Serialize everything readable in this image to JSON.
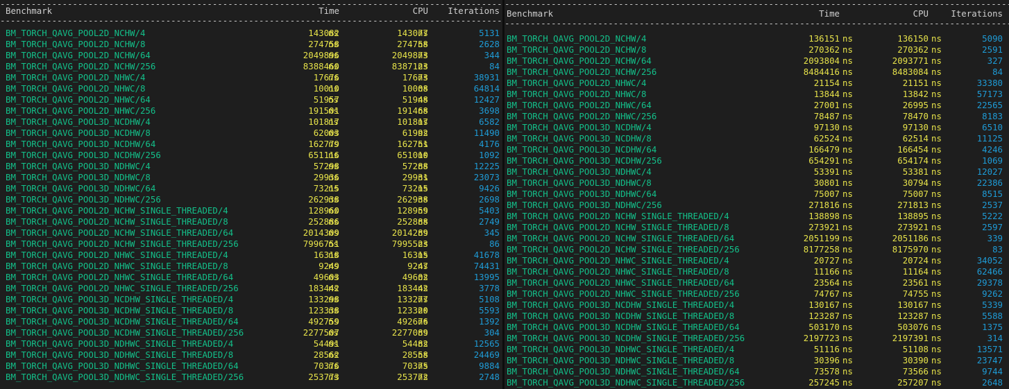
{
  "panels": [
    {
      "headers": {
        "benchmark": "Benchmark",
        "time": "Time",
        "cpu": "CPU",
        "iterations": "Iterations"
      },
      "separator": "--------------------------------------------------------------------------------------------------------",
      "rows": [
        {
          "name": "BM_TORCH_QAVG_POOL2D_NCHW/4",
          "time": "143082",
          "time_unit": "ns",
          "cpu": "143077",
          "cpu_unit": "ns",
          "iterations": "5131"
        },
        {
          "name": "BM_TORCH_QAVG_POOL2D_NCHW/8",
          "time": "274758",
          "time_unit": "ns",
          "cpu": "274758",
          "cpu_unit": "ns",
          "iterations": "2628"
        },
        {
          "name": "BM_TORCH_QAVG_POOL2D_NCHW/64",
          "time": "2049896",
          "time_unit": "ns",
          "cpu": "2049873",
          "cpu_unit": "ns",
          "iterations": "344"
        },
        {
          "name": "BM_TORCH_QAVG_POOL2D_NCHW/256",
          "time": "8388460",
          "time_unit": "ns",
          "cpu": "8387123",
          "cpu_unit": "ns",
          "iterations": "84"
        },
        {
          "name": "BM_TORCH_QAVG_POOL2D_NHWC/4",
          "time": "17676",
          "time_unit": "ns",
          "cpu": "17673",
          "cpu_unit": "ns",
          "iterations": "38931"
        },
        {
          "name": "BM_TORCH_QAVG_POOL2D_NHWC/8",
          "time": "10010",
          "time_unit": "ns",
          "cpu": "10008",
          "cpu_unit": "ns",
          "iterations": "64814"
        },
        {
          "name": "BM_TORCH_QAVG_POOL2D_NHWC/64",
          "time": "51957",
          "time_unit": "ns",
          "cpu": "51948",
          "cpu_unit": "ns",
          "iterations": "12427"
        },
        {
          "name": "BM_TORCH_QAVG_POOL2D_NHWC/256",
          "time": "191501",
          "time_unit": "ns",
          "cpu": "191468",
          "cpu_unit": "ns",
          "iterations": "3698"
        },
        {
          "name": "BM_TORCH_QAVG_POOL3D_NCDHW/4",
          "time": "101817",
          "time_unit": "ns",
          "cpu": "101817",
          "cpu_unit": "ns",
          "iterations": "6582"
        },
        {
          "name": "BM_TORCH_QAVG_POOL3D_NCDHW/8",
          "time": "62003",
          "time_unit": "ns",
          "cpu": "61992",
          "cpu_unit": "ns",
          "iterations": "11490"
        },
        {
          "name": "BM_TORCH_QAVG_POOL3D_NCDHW/64",
          "time": "162779",
          "time_unit": "ns",
          "cpu": "162751",
          "cpu_unit": "ns",
          "iterations": "4176"
        },
        {
          "name": "BM_TORCH_QAVG_POOL3D_NCDHW/256",
          "time": "651116",
          "time_unit": "ns",
          "cpu": "651010",
          "cpu_unit": "ns",
          "iterations": "1092"
        },
        {
          "name": "BM_TORCH_QAVG_POOL3D_NDHWC/4",
          "time": "57298",
          "time_unit": "ns",
          "cpu": "57288",
          "cpu_unit": "ns",
          "iterations": "12225"
        },
        {
          "name": "BM_TORCH_QAVG_POOL3D_NDHWC/8",
          "time": "29936",
          "time_unit": "ns",
          "cpu": "29931",
          "cpu_unit": "ns",
          "iterations": "23073"
        },
        {
          "name": "BM_TORCH_QAVG_POOL3D_NDHWC/64",
          "time": "73215",
          "time_unit": "ns",
          "cpu": "73215",
          "cpu_unit": "ns",
          "iterations": "9426"
        },
        {
          "name": "BM_TORCH_QAVG_POOL3D_NDHWC/256",
          "time": "262938",
          "time_unit": "ns",
          "cpu": "262938",
          "cpu_unit": "ns",
          "iterations": "2698"
        },
        {
          "name": "BM_TORCH_QAVG_POOL2D_NCHW_SINGLE_THREADED/4",
          "time": "128960",
          "time_unit": "ns",
          "cpu": "128959",
          "cpu_unit": "ns",
          "iterations": "5403"
        },
        {
          "name": "BM_TORCH_QAVG_POOL2D_NCHW_SINGLE_THREADED/8",
          "time": "252886",
          "time_unit": "ns",
          "cpu": "252888",
          "cpu_unit": "ns",
          "iterations": "2749"
        },
        {
          "name": "BM_TORCH_QAVG_POOL2D_NCHW_SINGLE_THREADED/64",
          "time": "2014309",
          "time_unit": "ns",
          "cpu": "2014289",
          "cpu_unit": "ns",
          "iterations": "345"
        },
        {
          "name": "BM_TORCH_QAVG_POOL2D_NCHW_SINGLE_THREADED/256",
          "time": "7996751",
          "time_unit": "ns",
          "cpu": "7995523",
          "cpu_unit": "ns",
          "iterations": "86"
        },
        {
          "name": "BM_TORCH_QAVG_POOL2D_NHWC_SINGLE_THREADED/4",
          "time": "16318",
          "time_unit": "ns",
          "cpu": "16315",
          "cpu_unit": "ns",
          "iterations": "41678"
        },
        {
          "name": "BM_TORCH_QAVG_POOL2D_NHWC_SINGLE_THREADED/8",
          "time": "9249",
          "time_unit": "ns",
          "cpu": "9247",
          "cpu_unit": "ns",
          "iterations": "74431"
        },
        {
          "name": "BM_TORCH_QAVG_POOL2D_NHWC_SINGLE_THREADED/64",
          "time": "49603",
          "time_unit": "ns",
          "cpu": "49602",
          "cpu_unit": "ns",
          "iterations": "13995"
        },
        {
          "name": "BM_TORCH_QAVG_POOL2D_NHWC_SINGLE_THREADED/256",
          "time": "183442",
          "time_unit": "ns",
          "cpu": "183442",
          "cpu_unit": "ns",
          "iterations": "3778"
        },
        {
          "name": "BM_TORCH_QAVG_POOL3D_NCDHW_SINGLE_THREADED/4",
          "time": "133298",
          "time_unit": "ns",
          "cpu": "133277",
          "cpu_unit": "ns",
          "iterations": "5108"
        },
        {
          "name": "BM_TORCH_QAVG_POOL3D_NCDHW_SINGLE_THREADED/8",
          "time": "123338",
          "time_unit": "ns",
          "cpu": "123320",
          "cpu_unit": "ns",
          "iterations": "5593"
        },
        {
          "name": "BM_TORCH_QAVG_POOL3D_NCDHW_SINGLE_THREADED/64",
          "time": "492759",
          "time_unit": "ns",
          "cpu": "492676",
          "cpu_unit": "ns",
          "iterations": "1392"
        },
        {
          "name": "BM_TORCH_QAVG_POOL3D_NCDHW_SINGLE_THREADED/256",
          "time": "2277507",
          "time_unit": "ns",
          "cpu": "2277089",
          "cpu_unit": "ns",
          "iterations": "304"
        },
        {
          "name": "BM_TORCH_QAVG_POOL3D_NDHWC_SINGLE_THREADED/4",
          "time": "54491",
          "time_unit": "ns",
          "cpu": "54482",
          "cpu_unit": "ns",
          "iterations": "12565"
        },
        {
          "name": "BM_TORCH_QAVG_POOL3D_NDHWC_SINGLE_THREADED/8",
          "time": "28562",
          "time_unit": "ns",
          "cpu": "28558",
          "cpu_unit": "ns",
          "iterations": "24469"
        },
        {
          "name": "BM_TORCH_QAVG_POOL3D_NDHWC_SINGLE_THREADED/64",
          "time": "70376",
          "time_unit": "ns",
          "cpu": "70375",
          "cpu_unit": "ns",
          "iterations": "9884"
        },
        {
          "name": "BM_TORCH_QAVG_POOL3D_NDHWC_SINGLE_THREADED/256",
          "time": "253773",
          "time_unit": "ns",
          "cpu": "253772",
          "cpu_unit": "ns",
          "iterations": "2748"
        }
      ]
    },
    {
      "headers": {
        "benchmark": "Benchmark",
        "time": "Time",
        "cpu": "CPU",
        "iterations": "Iterations"
      },
      "separator": "--------------------------------------------------------------------------------------------------------",
      "rows": [
        {
          "name": "BM_TORCH_QAVG_POOL2D_NCHW/4",
          "time": "136151",
          "time_unit": "ns",
          "cpu": "136150",
          "cpu_unit": "ns",
          "iterations": "5090"
        },
        {
          "name": "BM_TORCH_QAVG_POOL2D_NCHW/8",
          "time": "270362",
          "time_unit": "ns",
          "cpu": "270362",
          "cpu_unit": "ns",
          "iterations": "2591"
        },
        {
          "name": "BM_TORCH_QAVG_POOL2D_NCHW/64",
          "time": "2093804",
          "time_unit": "ns",
          "cpu": "2093771",
          "cpu_unit": "ns",
          "iterations": "327"
        },
        {
          "name": "BM_TORCH_QAVG_POOL2D_NCHW/256",
          "time": "8484416",
          "time_unit": "ns",
          "cpu": "8483084",
          "cpu_unit": "ns",
          "iterations": "84"
        },
        {
          "name": "BM_TORCH_QAVG_POOL2D_NHWC/4",
          "time": "21154",
          "time_unit": "ns",
          "cpu": "21151",
          "cpu_unit": "ns",
          "iterations": "33380"
        },
        {
          "name": "BM_TORCH_QAVG_POOL2D_NHWC/8",
          "time": "13844",
          "time_unit": "ns",
          "cpu": "13842",
          "cpu_unit": "ns",
          "iterations": "57173"
        },
        {
          "name": "BM_TORCH_QAVG_POOL2D_NHWC/64",
          "time": "27001",
          "time_unit": "ns",
          "cpu": "26995",
          "cpu_unit": "ns",
          "iterations": "22565"
        },
        {
          "name": "BM_TORCH_QAVG_POOL2D_NHWC/256",
          "time": "78487",
          "time_unit": "ns",
          "cpu": "78470",
          "cpu_unit": "ns",
          "iterations": "8183"
        },
        {
          "name": "BM_TORCH_QAVG_POOL3D_NCDHW/4",
          "time": "97130",
          "time_unit": "ns",
          "cpu": "97130",
          "cpu_unit": "ns",
          "iterations": "6510"
        },
        {
          "name": "BM_TORCH_QAVG_POOL3D_NCDHW/8",
          "time": "62524",
          "time_unit": "ns",
          "cpu": "62514",
          "cpu_unit": "ns",
          "iterations": "11125"
        },
        {
          "name": "BM_TORCH_QAVG_POOL3D_NCDHW/64",
          "time": "166479",
          "time_unit": "ns",
          "cpu": "166454",
          "cpu_unit": "ns",
          "iterations": "4246"
        },
        {
          "name": "BM_TORCH_QAVG_POOL3D_NCDHW/256",
          "time": "654291",
          "time_unit": "ns",
          "cpu": "654174",
          "cpu_unit": "ns",
          "iterations": "1069"
        },
        {
          "name": "BM_TORCH_QAVG_POOL3D_NDHWC/4",
          "time": "53391",
          "time_unit": "ns",
          "cpu": "53381",
          "cpu_unit": "ns",
          "iterations": "12027"
        },
        {
          "name": "BM_TORCH_QAVG_POOL3D_NDHWC/8",
          "time": "30801",
          "time_unit": "ns",
          "cpu": "30794",
          "cpu_unit": "ns",
          "iterations": "22386"
        },
        {
          "name": "BM_TORCH_QAVG_POOL3D_NDHWC/64",
          "time": "75007",
          "time_unit": "ns",
          "cpu": "75007",
          "cpu_unit": "ns",
          "iterations": "8515"
        },
        {
          "name": "BM_TORCH_QAVG_POOL3D_NDHWC/256",
          "time": "271816",
          "time_unit": "ns",
          "cpu": "271813",
          "cpu_unit": "ns",
          "iterations": "2537"
        },
        {
          "name": "BM_TORCH_QAVG_POOL2D_NCHW_SINGLE_THREADED/4",
          "time": "138898",
          "time_unit": "ns",
          "cpu": "138895",
          "cpu_unit": "ns",
          "iterations": "5222"
        },
        {
          "name": "BM_TORCH_QAVG_POOL2D_NCHW_SINGLE_THREADED/8",
          "time": "273921",
          "time_unit": "ns",
          "cpu": "273921",
          "cpu_unit": "ns",
          "iterations": "2597"
        },
        {
          "name": "BM_TORCH_QAVG_POOL2D_NCHW_SINGLE_THREADED/64",
          "time": "2051199",
          "time_unit": "ns",
          "cpu": "2051186",
          "cpu_unit": "ns",
          "iterations": "339"
        },
        {
          "name": "BM_TORCH_QAVG_POOL2D_NCHW_SINGLE_THREADED/256",
          "time": "8177258",
          "time_unit": "ns",
          "cpu": "8175970",
          "cpu_unit": "ns",
          "iterations": "83"
        },
        {
          "name": "BM_TORCH_QAVG_POOL2D_NHWC_SINGLE_THREADED/4",
          "time": "20727",
          "time_unit": "ns",
          "cpu": "20724",
          "cpu_unit": "ns",
          "iterations": "34052"
        },
        {
          "name": "BM_TORCH_QAVG_POOL2D_NHWC_SINGLE_THREADED/8",
          "time": "11166",
          "time_unit": "ns",
          "cpu": "11164",
          "cpu_unit": "ns",
          "iterations": "62466"
        },
        {
          "name": "BM_TORCH_QAVG_POOL2D_NHWC_SINGLE_THREADED/64",
          "time": "23564",
          "time_unit": "ns",
          "cpu": "23561",
          "cpu_unit": "ns",
          "iterations": "29378"
        },
        {
          "name": "BM_TORCH_QAVG_POOL2D_NHWC_SINGLE_THREADED/256",
          "time": "74767",
          "time_unit": "ns",
          "cpu": "74755",
          "cpu_unit": "ns",
          "iterations": "9262"
        },
        {
          "name": "BM_TORCH_QAVG_POOL3D_NCDHW_SINGLE_THREADED/4",
          "time": "130167",
          "time_unit": "ns",
          "cpu": "130167",
          "cpu_unit": "ns",
          "iterations": "5339"
        },
        {
          "name": "BM_TORCH_QAVG_POOL3D_NCDHW_SINGLE_THREADED/8",
          "time": "123287",
          "time_unit": "ns",
          "cpu": "123287",
          "cpu_unit": "ns",
          "iterations": "5588"
        },
        {
          "name": "BM_TORCH_QAVG_POOL3D_NCDHW_SINGLE_THREADED/64",
          "time": "503170",
          "time_unit": "ns",
          "cpu": "503076",
          "cpu_unit": "ns",
          "iterations": "1375"
        },
        {
          "name": "BM_TORCH_QAVG_POOL3D_NCDHW_SINGLE_THREADED/256",
          "time": "2197723",
          "time_unit": "ns",
          "cpu": "2197391",
          "cpu_unit": "ns",
          "iterations": "314"
        },
        {
          "name": "BM_TORCH_QAVG_POOL3D_NDHWC_SINGLE_THREADED/4",
          "time": "51116",
          "time_unit": "ns",
          "cpu": "51108",
          "cpu_unit": "ns",
          "iterations": "13571"
        },
        {
          "name": "BM_TORCH_QAVG_POOL3D_NDHWC_SINGLE_THREADED/8",
          "time": "30396",
          "time_unit": "ns",
          "cpu": "30390",
          "cpu_unit": "ns",
          "iterations": "23747"
        },
        {
          "name": "BM_TORCH_QAVG_POOL3D_NDHWC_SINGLE_THREADED/64",
          "time": "73578",
          "time_unit": "ns",
          "cpu": "73566",
          "cpu_unit": "ns",
          "iterations": "9744"
        },
        {
          "name": "BM_TORCH_QAVG_POOL3D_NDHWC_SINGLE_THREADED/256",
          "time": "257245",
          "time_unit": "ns",
          "cpu": "257207",
          "cpu_unit": "ns",
          "iterations": "2648"
        }
      ]
    }
  ],
  "colors": {
    "background": "#1e1e1e",
    "benchmark_name": "#13c08a",
    "time_cpu": "#e6e24a",
    "iterations": "#1e9bd6",
    "header": "#cfcfcf"
  }
}
